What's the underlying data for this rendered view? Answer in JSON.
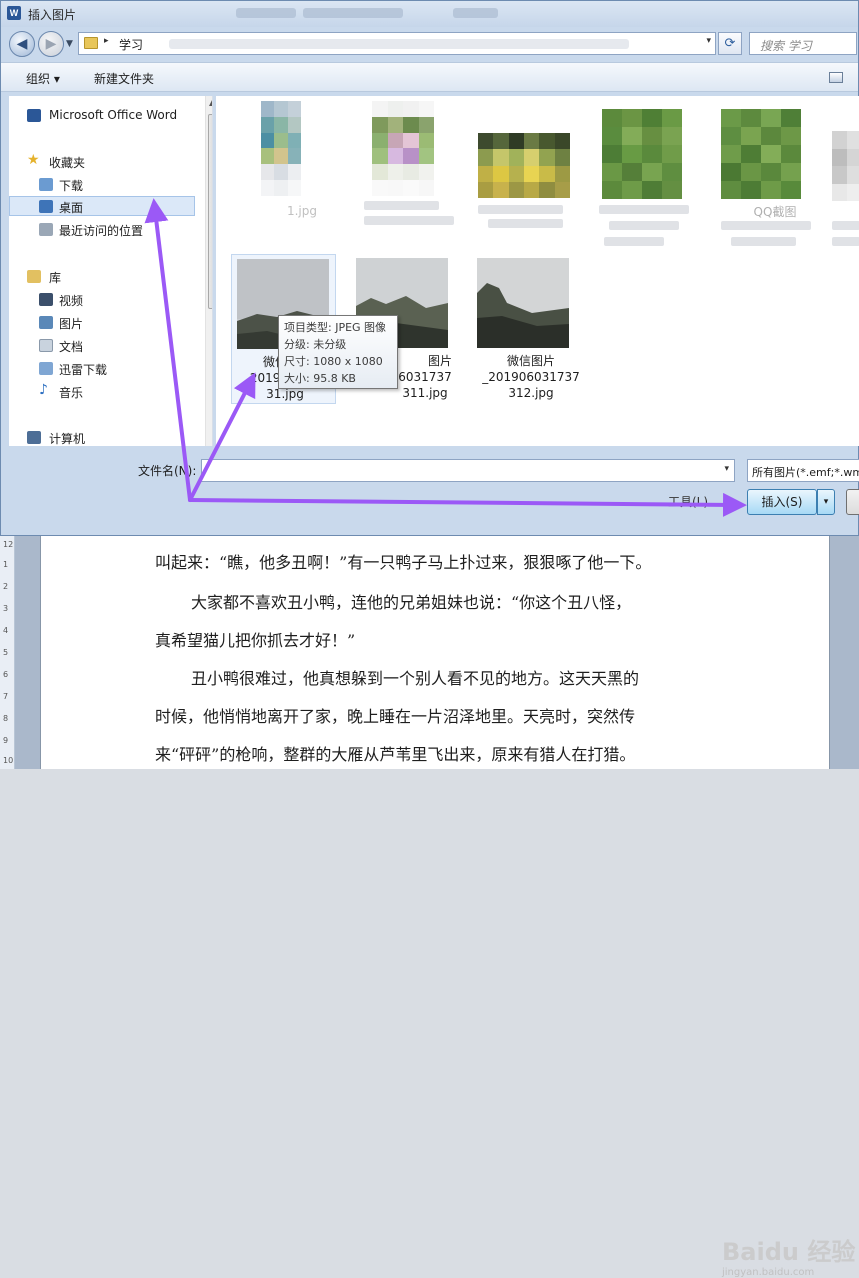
{
  "window": {
    "title": "插入图片"
  },
  "nav": {
    "back_icon": "back-arrow-icon",
    "forward_icon": "forward-arrow-icon"
  },
  "address": {
    "folder": "学习",
    "separator": "▸",
    "dropdown": "▾"
  },
  "search": {
    "placeholder": "搜索 学习"
  },
  "toolbar": {
    "organize_label": "组织 ▾",
    "new_folder_label": "新建文件夹"
  },
  "navpane": {
    "items": [
      {
        "label": "Microsoft Office Word",
        "icon": "word-icon"
      },
      {
        "label": "收藏夹",
        "icon": "star-icon"
      },
      {
        "label": "下载",
        "icon": "download-folder-icon"
      },
      {
        "label": "桌面",
        "icon": "desktop-icon",
        "selected": true
      },
      {
        "label": "最近访问的位置",
        "icon": "recent-places-icon"
      },
      {
        "label": "库",
        "icon": "library-icon"
      },
      {
        "label": "视频",
        "icon": "video-icon"
      },
      {
        "label": "图片",
        "icon": "pictures-icon"
      },
      {
        "label": "文档",
        "icon": "documents-icon"
      },
      {
        "label": "迅雷下载",
        "icon": "thunder-download-icon"
      },
      {
        "label": "音乐",
        "icon": "music-icon"
      },
      {
        "label": "计算机",
        "icon": "computer-icon"
      }
    ]
  },
  "files": {
    "row1": [
      {
        "name": "1.jpg"
      },
      {
        "name": ""
      },
      {
        "name": ""
      },
      {
        "name": "QQ截图"
      },
      {
        "name": ""
      }
    ],
    "row2": [
      {
        "name_line1": "微信图",
        "name_line2": "20190",
        "name_line3": "31.jpg"
      },
      {
        "name_line1": "图片",
        "name_line2": "6031737",
        "name_line3": "311.jpg"
      },
      {
        "name_line1": "微信图片",
        "name_line2": "_201906031737",
        "name_line3": "312.jpg"
      }
    ]
  },
  "tooltip": {
    "type": "项目类型: JPEG 图像",
    "rating": "分级: 未分级",
    "size": "尺寸: 1080 x 1080",
    "filesize": "大小: 95.8 KB"
  },
  "bottom": {
    "filename_label": "文件名(N):",
    "filename_value": "",
    "filetype": "所有图片(*.emf;*.wm",
    "tools_label": "工具(L)",
    "insert_label": "插入(S)",
    "dropdown": "▾"
  },
  "document": {
    "ruler": [
      "12",
      "1",
      "2",
      "3",
      "4",
      "5",
      "6",
      "7",
      "8",
      "9",
      "10"
    ],
    "lines": [
      "叫起来：“瞧，他多丑啊！”有一只鸭子马上扑过来，狠狠啄了他一下。",
      "大家都不喜欢丑小鸭，连他的兄弟姐妹也说：“你这个丑八怪，",
      "真希望猫儿把你抓去才好！”",
      "丑小鸭很难过，他真想躲到一个别人看不见的地方。这天天黑的",
      "时候，他悄悄地离开了家，晚上睡在一片沼泽地里。天亮时，突然传",
      "来“砰砰”的枪响，整群的大雁从芦苇里飞出来，原来有猎人在打猎。"
    ]
  },
  "watermark": {
    "logo": "Baidu 经验",
    "url": "jingyan.baidu.com"
  },
  "colors": {
    "accent": "#9b59f6",
    "selection": "#dbe8f8"
  }
}
